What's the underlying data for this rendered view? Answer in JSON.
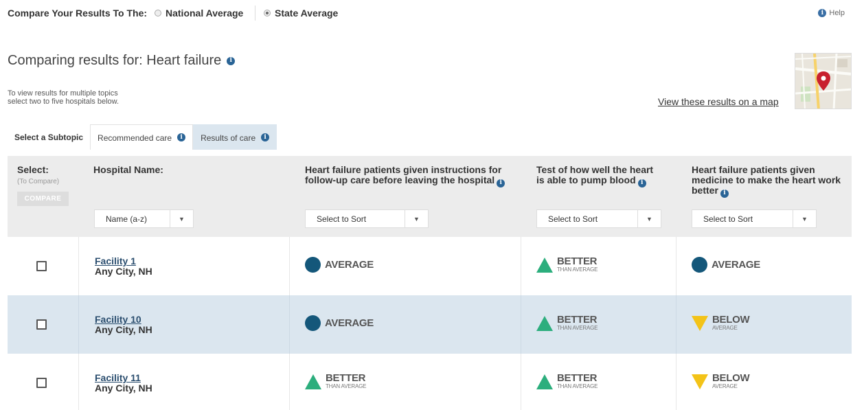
{
  "compare": {
    "label": "Compare Your Results To The:",
    "options": [
      "National Average",
      "State Average"
    ],
    "selected": "State Average"
  },
  "help": "Help",
  "title": "Comparing results for: Heart failure",
  "instructions": [
    "To view results for multiple topics",
    "select two to five hospitals below."
  ],
  "map_link": "View these results on a map",
  "subtopic": {
    "label": "Select a Subtopic",
    "tabs": [
      "Recommended care",
      "Results of care"
    ],
    "active": "Results of care"
  },
  "table": {
    "select_header": "Select:",
    "select_sub": "(To Compare)",
    "compare_button": "COMPARE",
    "hospital_header": "Hospital Name:",
    "hospital_sort": "Name (a-z)",
    "columns": [
      {
        "header": "Heart failure patients given instructions for follow-up care before leaving the hospital",
        "sort": "Select to Sort"
      },
      {
        "header": "Test of how well the heart is able to pump blood",
        "sort": "Select to Sort"
      },
      {
        "header": "Heart failure patients given medicine to make the heart work better",
        "sort": "Select to Sort"
      }
    ],
    "rows": [
      {
        "facility": "Facility 1",
        "location": "Any City, NH",
        "results": [
          {
            "kind": "average",
            "word": "AVERAGE",
            "sub": ""
          },
          {
            "kind": "better",
            "word": "BETTER",
            "sub": "THAN AVERAGE"
          },
          {
            "kind": "average",
            "word": "AVERAGE",
            "sub": ""
          }
        ]
      },
      {
        "facility": "Facility 10",
        "location": "Any City, NH",
        "results": [
          {
            "kind": "average",
            "word": "AVERAGE",
            "sub": ""
          },
          {
            "kind": "better",
            "word": "BETTER",
            "sub": "THAN AVERAGE"
          },
          {
            "kind": "below",
            "word": "BELOW",
            "sub": "AVERAGE"
          }
        ]
      },
      {
        "facility": "Facility 11",
        "location": "Any City, NH",
        "results": [
          {
            "kind": "better",
            "word": "BETTER",
            "sub": "THAN AVERAGE"
          },
          {
            "kind": "better",
            "word": "BETTER",
            "sub": "THAN AVERAGE"
          },
          {
            "kind": "below",
            "word": "BELOW",
            "sub": "AVERAGE"
          }
        ]
      }
    ]
  },
  "colors": {
    "average": "#14577a",
    "better": "#2cae7d",
    "below": "#f3c318",
    "row_highlight": "#dbe6ef",
    "header_bg": "#ececec",
    "info_icon": "#2a6496"
  }
}
